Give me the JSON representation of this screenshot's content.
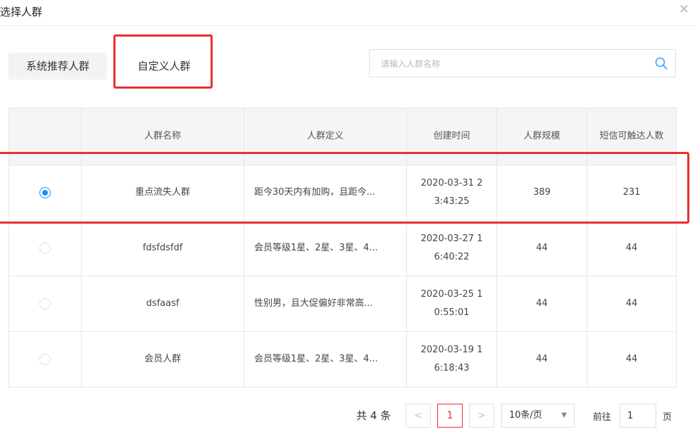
{
  "dialog": {
    "title": "选择人群",
    "close": "×"
  },
  "tabs": [
    {
      "label": "系统推荐人群"
    },
    {
      "label": "自定义人群"
    }
  ],
  "search": {
    "placeholder": "请输入人群名称",
    "value": ""
  },
  "table": {
    "headers": [
      "",
      "人群名称",
      "人群定义",
      "创建时间",
      "人群规模",
      "短信可触达人数"
    ],
    "rows": [
      {
        "selected": true,
        "name": "重点流失人群",
        "definition": "距今30天内有加购，且距今...",
        "created": "2020-03-31 23:43:25",
        "size": "389",
        "reach": "231"
      },
      {
        "selected": false,
        "name": "fdsfdsfdf",
        "definition": "会员等级1星、2星、3星、4...",
        "created": "2020-03-27 16:40:22",
        "size": "44",
        "reach": "44"
      },
      {
        "selected": false,
        "name": "dsfaasf",
        "definition": "性别男，且大促偏好非常高...",
        "created": "2020-03-25 10:55:01",
        "size": "44",
        "reach": "44"
      },
      {
        "selected": false,
        "name": "会员人群",
        "definition": "会员等级1星、2星、3星、4...",
        "created": "2020-03-19 16:18:43",
        "size": "44",
        "reach": "44"
      }
    ]
  },
  "pagination": {
    "total": "共 4 条",
    "prev": "<",
    "current": "1",
    "next": ">",
    "page_size": "10条/页",
    "goto_label": "前往",
    "goto_value": "1",
    "goto_unit": "页"
  },
  "colors": {
    "accent": "#1890ff",
    "highlight": "#ea2e2e"
  }
}
